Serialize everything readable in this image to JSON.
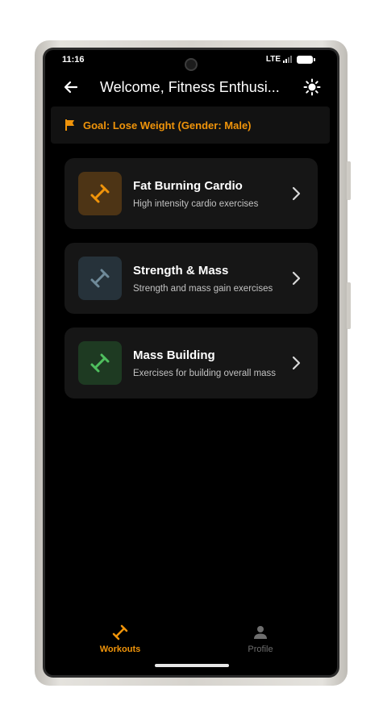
{
  "status_bar": {
    "time": "11:16",
    "network": "LTE"
  },
  "app_bar": {
    "title": "Welcome, Fitness Enthusi..."
  },
  "goal_banner": {
    "text": "Goal: Lose Weight (Gender: Male)",
    "color": "#f0940a"
  },
  "workout_categories": [
    {
      "title": "Fat Burning Cardio",
      "subtitle": "High intensity cardio exercises",
      "icon": "dumbbell-icon",
      "accent_color": "#f0940a"
    },
    {
      "title": "Strength & Mass",
      "subtitle": "Strength and mass gain exercises",
      "icon": "dumbbell-icon",
      "accent_color": "#6f8a99"
    },
    {
      "title": "Mass Building",
      "subtitle": "Exercises for building overall mass",
      "icon": "dumbbell-icon",
      "accent_color": "#4fbf5e"
    }
  ],
  "bottom_nav": {
    "items": [
      {
        "label": "Workouts",
        "icon": "dumbbell-icon",
        "active": true
      },
      {
        "label": "Profile",
        "icon": "person-icon",
        "active": false
      }
    ]
  },
  "colors": {
    "background": "#000000",
    "accent": "#f0940a",
    "card": "#161616"
  }
}
